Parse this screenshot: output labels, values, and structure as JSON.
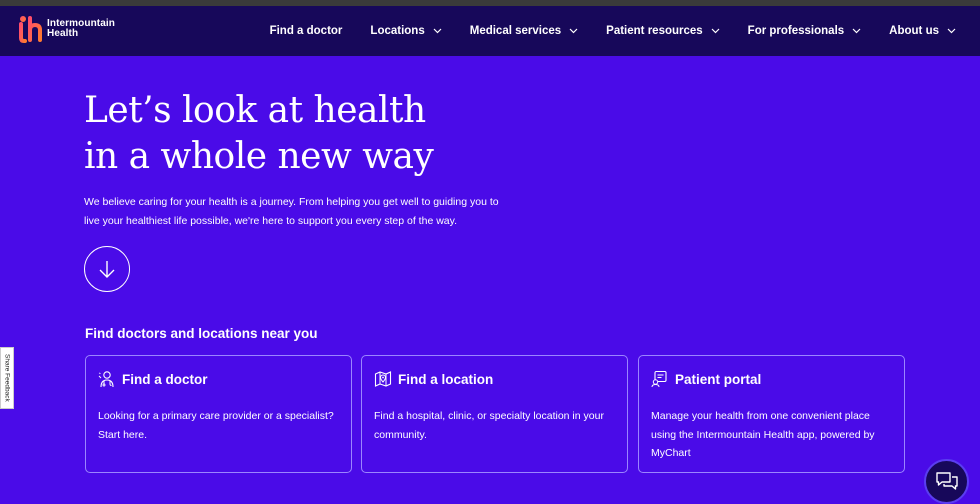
{
  "brand": {
    "line1": "Intermountain",
    "line2": "Health"
  },
  "nav": [
    {
      "label": "Find a doctor",
      "has_dropdown": false
    },
    {
      "label": "Locations",
      "has_dropdown": true
    },
    {
      "label": "Medical services",
      "has_dropdown": true
    },
    {
      "label": "Patient resources",
      "has_dropdown": true
    },
    {
      "label": "For professionals",
      "has_dropdown": true
    },
    {
      "label": "About us",
      "has_dropdown": true
    }
  ],
  "hero": {
    "title_line1": "Let’s look at health",
    "title_line2": "in a whole new way",
    "body": "We believe caring for your health is a journey. From helping you get well to guiding you to live your healthiest life possible, we're here to support you every step of the way."
  },
  "section": {
    "title": "Find doctors and locations near you"
  },
  "cards": [
    {
      "icon": "doctor-icon",
      "title": "Find a doctor",
      "description": "Looking for a primary care provider or a specialist? Start here."
    },
    {
      "icon": "location-map-icon",
      "title": "Find a location",
      "description": "Find a hospital, clinic, or specialty location in your community."
    },
    {
      "icon": "patient-portal-icon",
      "title": "Patient portal",
      "description": "Manage your health from one convenient place using the Intermountain Health app, powered by MyChart"
    }
  ],
  "feedback": {
    "label": "Share Feedback"
  },
  "colors": {
    "background": "#4a0be8",
    "navbar": "#17085a",
    "card_border": "#9b85ff",
    "logo_gradient_start": "#ff4d6d",
    "logo_gradient_end": "#ff7a2f"
  }
}
